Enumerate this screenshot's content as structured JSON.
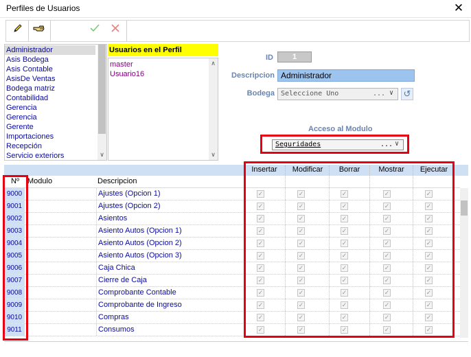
{
  "window": {
    "title": "Perfiles de Usuarios",
    "close_glyph": "✕"
  },
  "toolbar": {
    "edit_icon": "pencil-icon",
    "search_icon": "hand-pointer-icon",
    "accept_icon": "checkmark-icon",
    "cancel_icon": "x-icon",
    "accept_color": "#3cb043",
    "cancel_color": "#e05050"
  },
  "profiles": {
    "items": [
      "Administrador",
      "Asis Bodega",
      "Asis Contable",
      "AsisDe Ventas",
      "Bodega matriz",
      "Contabilidad",
      "Gerencia",
      "Gerencia",
      "Gerente",
      "Importaciones",
      "Recepción",
      "Servicio exteriors"
    ],
    "selected_index": 0
  },
  "users": {
    "header": "Usuarios en el Perfil",
    "items": [
      "master",
      "Usuario16"
    ]
  },
  "form": {
    "id_label": "ID",
    "id_value": "1",
    "desc_label": "Descripcion",
    "desc_value": "Administrador",
    "bodega_label": "Bodega",
    "bodega_value": "Seleccione Uno",
    "bodega_dots": "...",
    "refresh_icon": "refresh-icon"
  },
  "acceso": {
    "label": "Acceso al Modulo",
    "value": "Seguridades",
    "dots": "..."
  },
  "grid": {
    "columns": {
      "num": "Nº",
      "modulo": "Modulo",
      "descripcion": "Descripcion"
    },
    "perm_columns": [
      "Insertar",
      "Modificar",
      "Borrar",
      "Mostrar",
      "Ejecutar"
    ],
    "check_glyph": "✓",
    "rows": [
      {
        "num": "9000",
        "desc": "Ajustes (Opcion 1)"
      },
      {
        "num": "9001",
        "desc": "Ajustes (Opcion 2)"
      },
      {
        "num": "9002",
        "desc": "Asientos"
      },
      {
        "num": "9003",
        "desc": "Asiento Autos (Opcion 1)"
      },
      {
        "num": "9004",
        "desc": "Asiento Autos (Opcion 2)"
      },
      {
        "num": "9005",
        "desc": "Asiento Autos (Opcion 3)"
      },
      {
        "num": "9006",
        "desc": "Caja Chica"
      },
      {
        "num": "9007",
        "desc": "Cierre de Caja"
      },
      {
        "num": "9008",
        "desc": "Comprobante Contable"
      },
      {
        "num": "9009",
        "desc": "Comprobante de Ingreso"
      },
      {
        "num": "9010",
        "desc": "Compras"
      },
      {
        "num": "9011",
        "desc": "Consumos"
      }
    ]
  },
  "colors": {
    "highlight": "#e60012",
    "label": "#6a84b0",
    "link": "#0a0a9c",
    "grid_header": "#cfe0f5"
  }
}
